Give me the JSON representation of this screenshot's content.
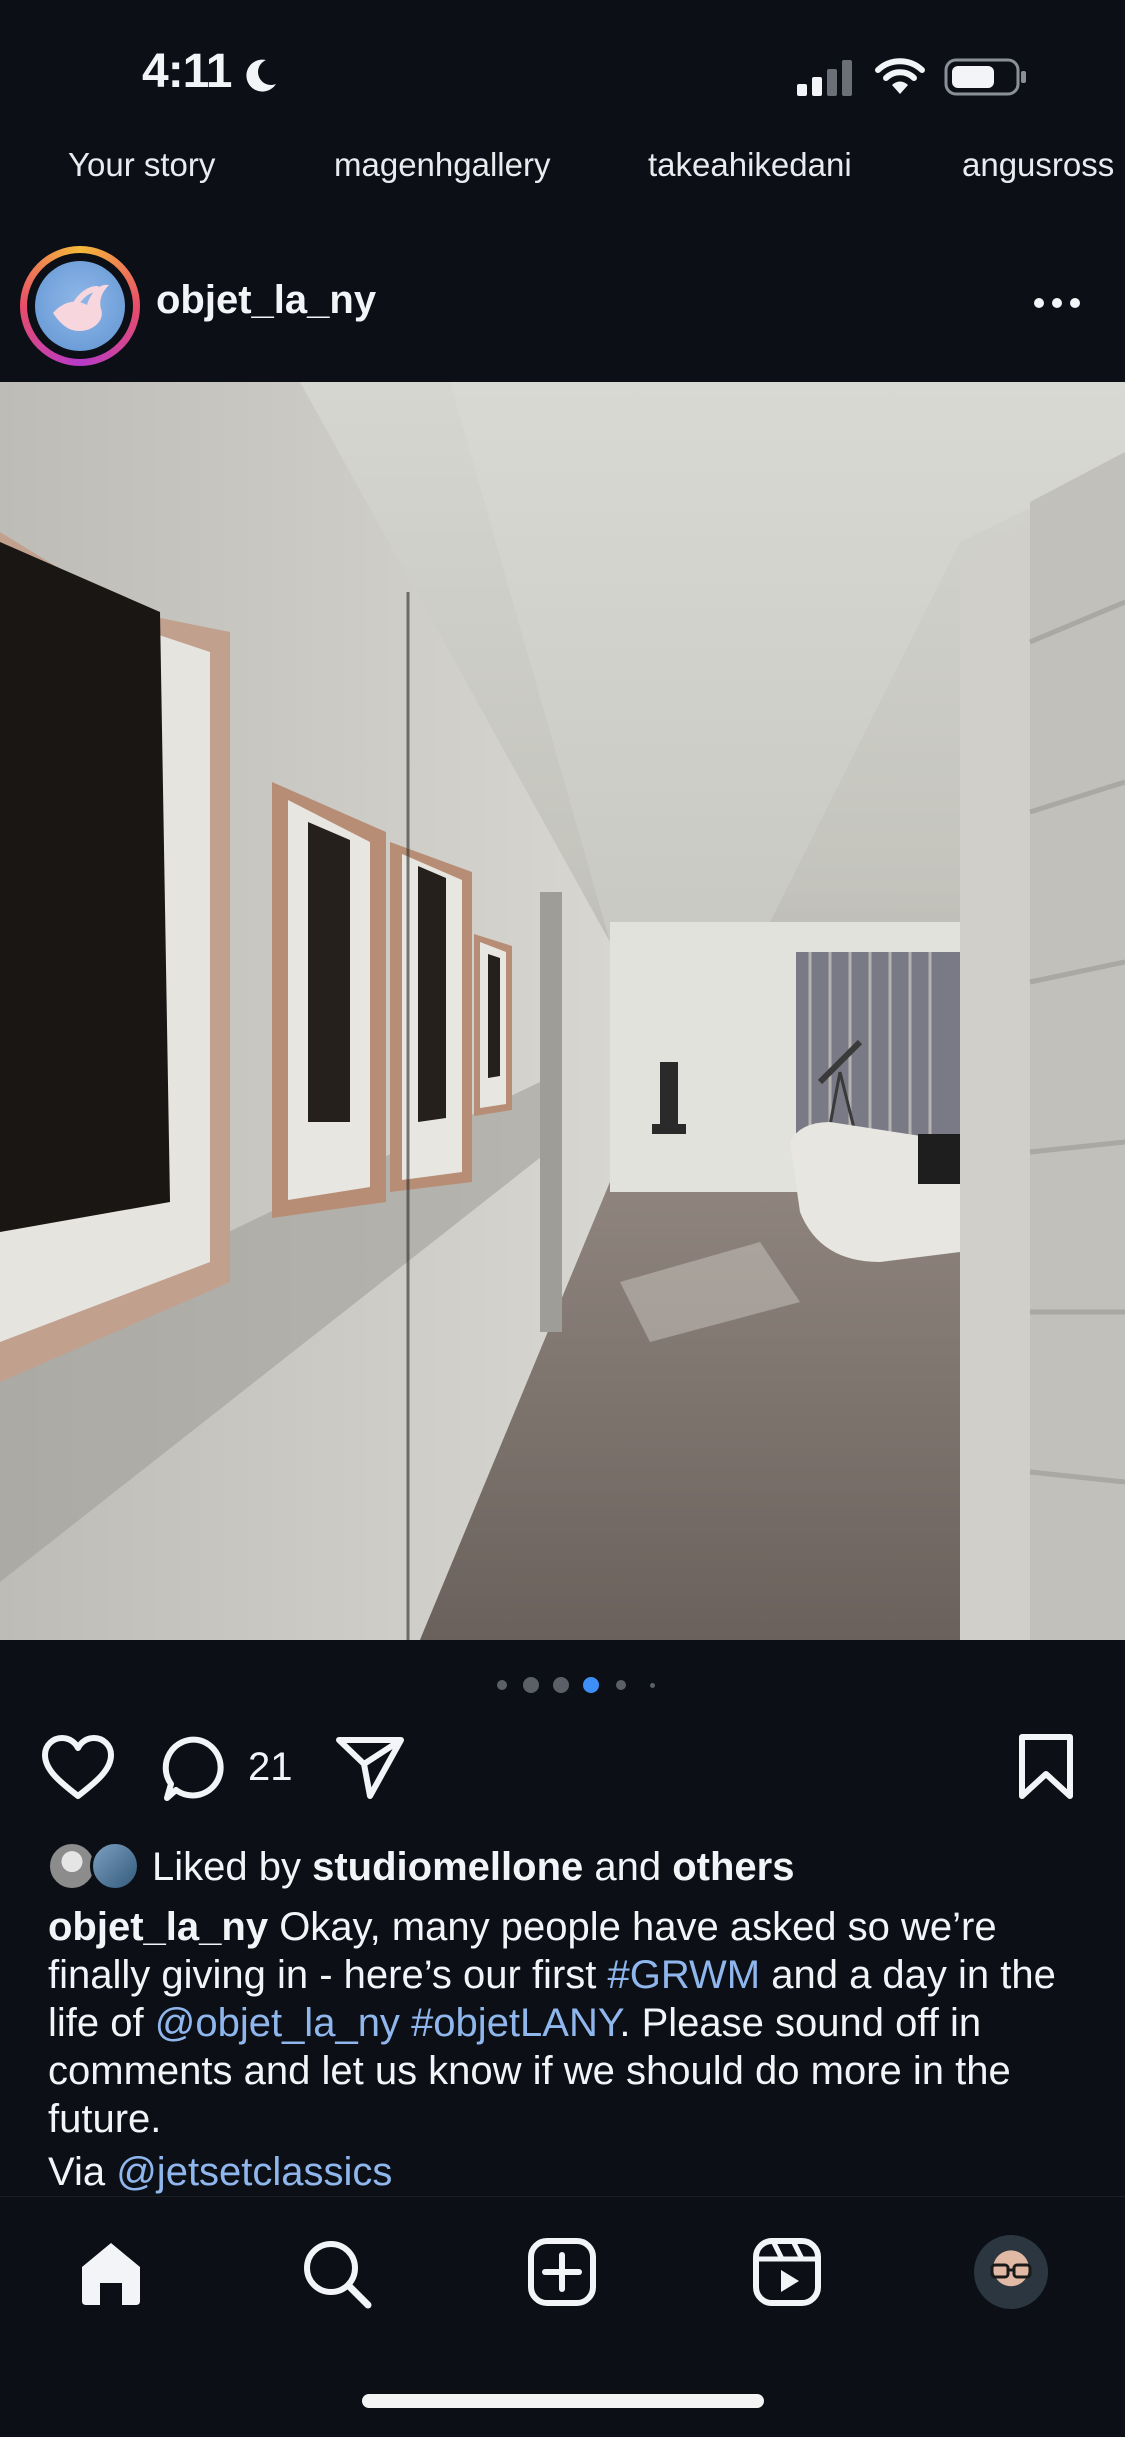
{
  "status_bar": {
    "time": "4:11"
  },
  "stories": {
    "labels": [
      "Your story",
      "magenhgallery",
      "takeahikedani",
      "angusross"
    ]
  },
  "post": {
    "username": "objet_la_ny",
    "carousel": {
      "count": 6,
      "active_index": 3
    },
    "comment_count": "21",
    "likes": {
      "prefix": "Liked by ",
      "user": "studiomellone",
      "middle": " and ",
      "others": "others"
    },
    "caption": {
      "username": "objet_la_ny",
      "text_1": " Okay, many people have asked so we’re finally giving in - here’s our first ",
      "hashtag_1": "#GRWM",
      "text_2": " and a day in the life of ",
      "mention_1": "@objet_la_ny",
      "space": " ",
      "hashtag_2": "#objetLANY",
      "text_3": ". Please sound off in comments and let us know if we should do more in the future.",
      "via_label": "Via ",
      "via_mention": "@jetsetclassics"
    }
  },
  "nav": {
    "items": [
      "home-icon",
      "search-icon",
      "create-icon",
      "reels-icon",
      "profile-avatar"
    ]
  },
  "colors": {
    "background": "#0c1016",
    "link": "#8fb7ee",
    "active_dot": "#3d8ef7"
  }
}
